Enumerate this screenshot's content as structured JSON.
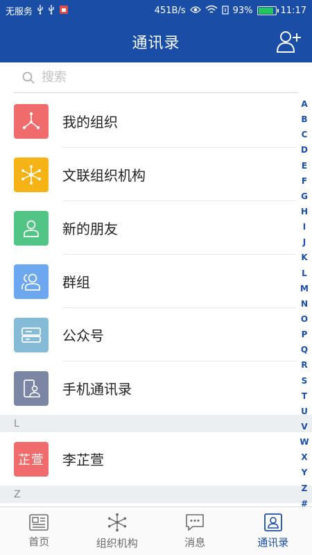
{
  "status_bar": {
    "carrier": "无服务",
    "speed": "451B/s",
    "battery": "93%",
    "battery_level": 0.93,
    "time": "11:17"
  },
  "header": {
    "title": "通讯录"
  },
  "search": {
    "placeholder": "搜索"
  },
  "menu_items": [
    {
      "label": "我的组织",
      "icon": "org-tree-icon",
      "color": "#f06b6b"
    },
    {
      "label": "文联组织机构",
      "icon": "network-icon",
      "color": "#f5b316"
    },
    {
      "label": "新的朋友",
      "icon": "person-icon",
      "color": "#52c485"
    },
    {
      "label": "群组",
      "icon": "group-icon",
      "color": "#6da7ef"
    },
    {
      "label": "公众号",
      "icon": "public-account-icon",
      "color": "#86bbd8"
    },
    {
      "label": "手机通讯录",
      "icon": "phone-contacts-icon",
      "color": "#7a86a3"
    }
  ],
  "sections": [
    {
      "letter": "L",
      "contacts": [
        {
          "name": "李芷萱",
          "avatar_text": "芷萱",
          "color": "#f06b6b"
        }
      ]
    },
    {
      "letter": "Z",
      "contacts": []
    }
  ],
  "alphabet": [
    "A",
    "B",
    "C",
    "D",
    "E",
    "F",
    "G",
    "H",
    "I",
    "J",
    "K",
    "L",
    "M",
    "N",
    "O",
    "P",
    "Q",
    "R",
    "S",
    "T",
    "U",
    "V",
    "W",
    "X",
    "Y",
    "Z",
    "#"
  ],
  "bottom_nav": [
    {
      "label": "首页",
      "icon": "home-news-icon",
      "active": false
    },
    {
      "label": "组织机构",
      "icon": "organization-icon",
      "active": false
    },
    {
      "label": "消息",
      "icon": "message-icon",
      "active": false
    },
    {
      "label": "通讯录",
      "icon": "contacts-icon",
      "active": true
    }
  ],
  "colors": {
    "primary": "#1a4ea6",
    "inactive": "#6b6b6b"
  }
}
